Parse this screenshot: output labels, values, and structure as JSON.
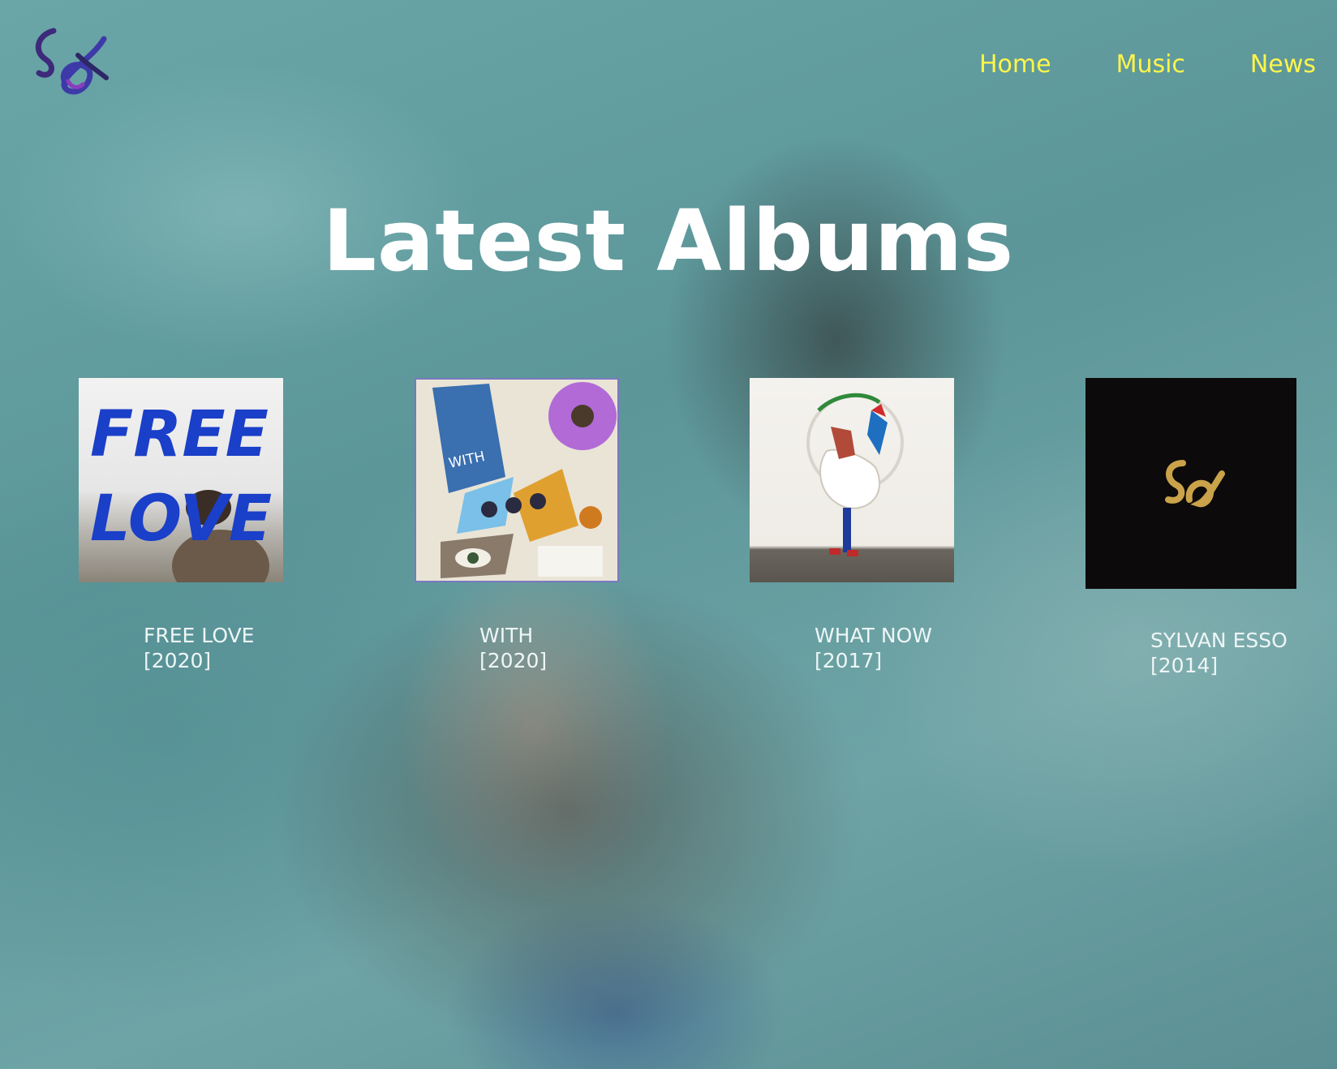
{
  "nav": {
    "home": "Home",
    "music": "Music",
    "news": "News"
  },
  "page": {
    "title": "Latest Albums"
  },
  "albums": [
    {
      "title": "FREE LOVE",
      "year": "[2020]",
      "cover_text_1": "FREE",
      "cover_text_2": "LOVE"
    },
    {
      "title": "WITH",
      "year": "[2020]",
      "cover_text": "WITH"
    },
    {
      "title": "WHAT NOW",
      "year": "[2017]"
    },
    {
      "title": "SYLVAN ESSO",
      "year": "[2014]"
    }
  ],
  "colors": {
    "nav_link": "#fff54a",
    "heading": "#ffffff",
    "album_label": "#eef6f6",
    "background": "#5e9a9c"
  }
}
